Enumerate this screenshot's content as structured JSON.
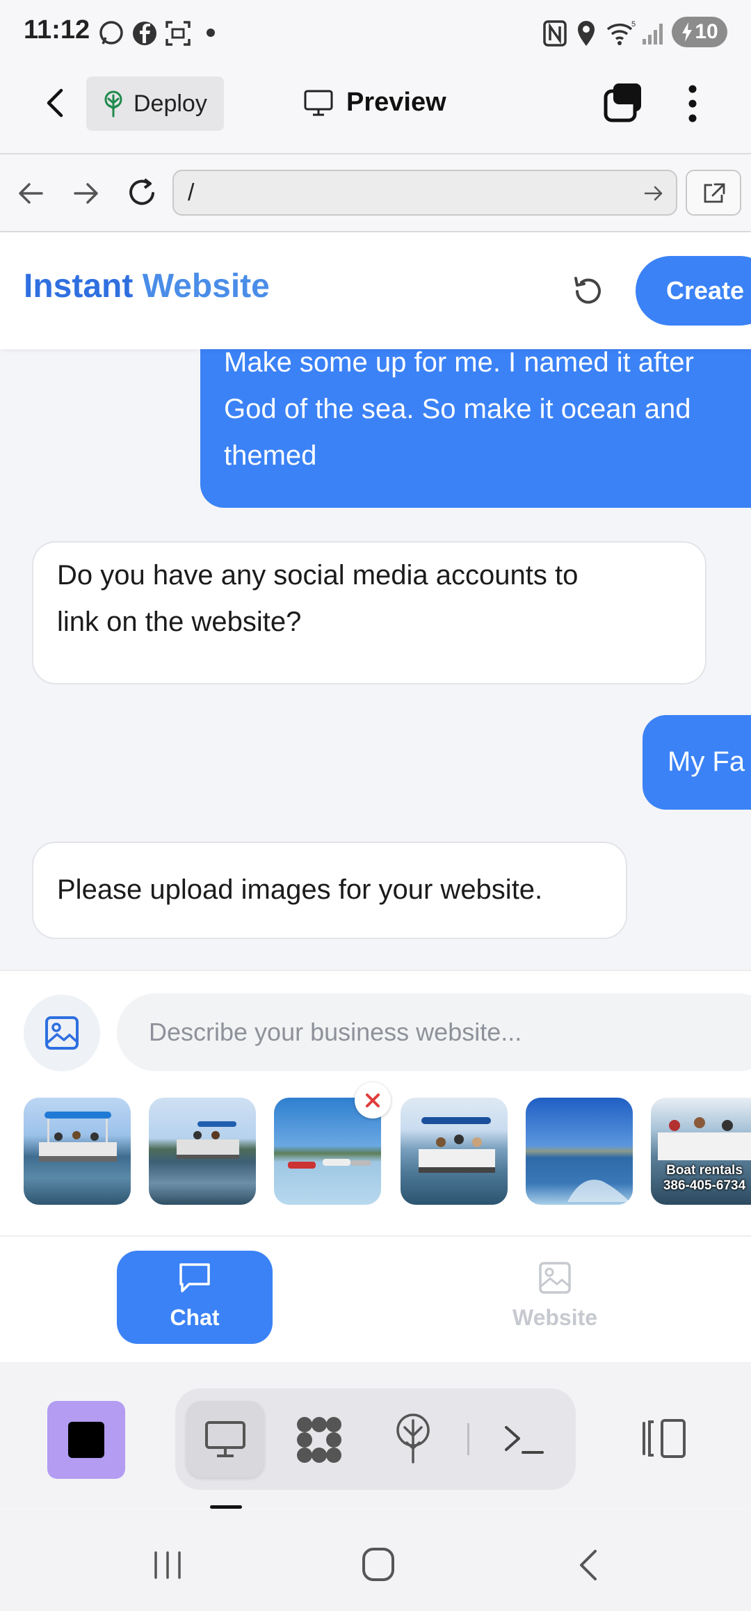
{
  "status_bar": {
    "time": "11:12",
    "battery": "10"
  },
  "app_bar": {
    "deploy_label": "Deploy",
    "preview_label": "Preview"
  },
  "browser": {
    "url": "/"
  },
  "site_header": {
    "brand_part1": "Instant",
    "brand_part2": "Website",
    "create_label": "Create"
  },
  "chat": {
    "user_message_1": [
      "Make some up for me. I named it after",
      "God of the sea. So make it ocean and",
      "themed"
    ],
    "bot_message_1": [
      "Do you have any social media accounts to",
      "link on the website?"
    ],
    "user_message_2": "My Fa",
    "bot_message_2": "Please upload images for your website."
  },
  "composer": {
    "placeholder": "Describe your business website...",
    "thumbnails": [
      {
        "name": "thumb-1"
      },
      {
        "name": "thumb-2"
      },
      {
        "name": "thumb-3",
        "removable": true
      },
      {
        "name": "thumb-4"
      },
      {
        "name": "thumb-5"
      },
      {
        "name": "thumb-6",
        "caption_line1": "Boat rentals",
        "caption_line2": "386-405-6734"
      }
    ]
  },
  "tabs": {
    "chat_label": "Chat",
    "website_label": "Website",
    "active": "chat"
  },
  "colors": {
    "accent": "#3b82f6",
    "brand_dark": "#2f6fe0",
    "dock_tile": "#b39cf2"
  }
}
